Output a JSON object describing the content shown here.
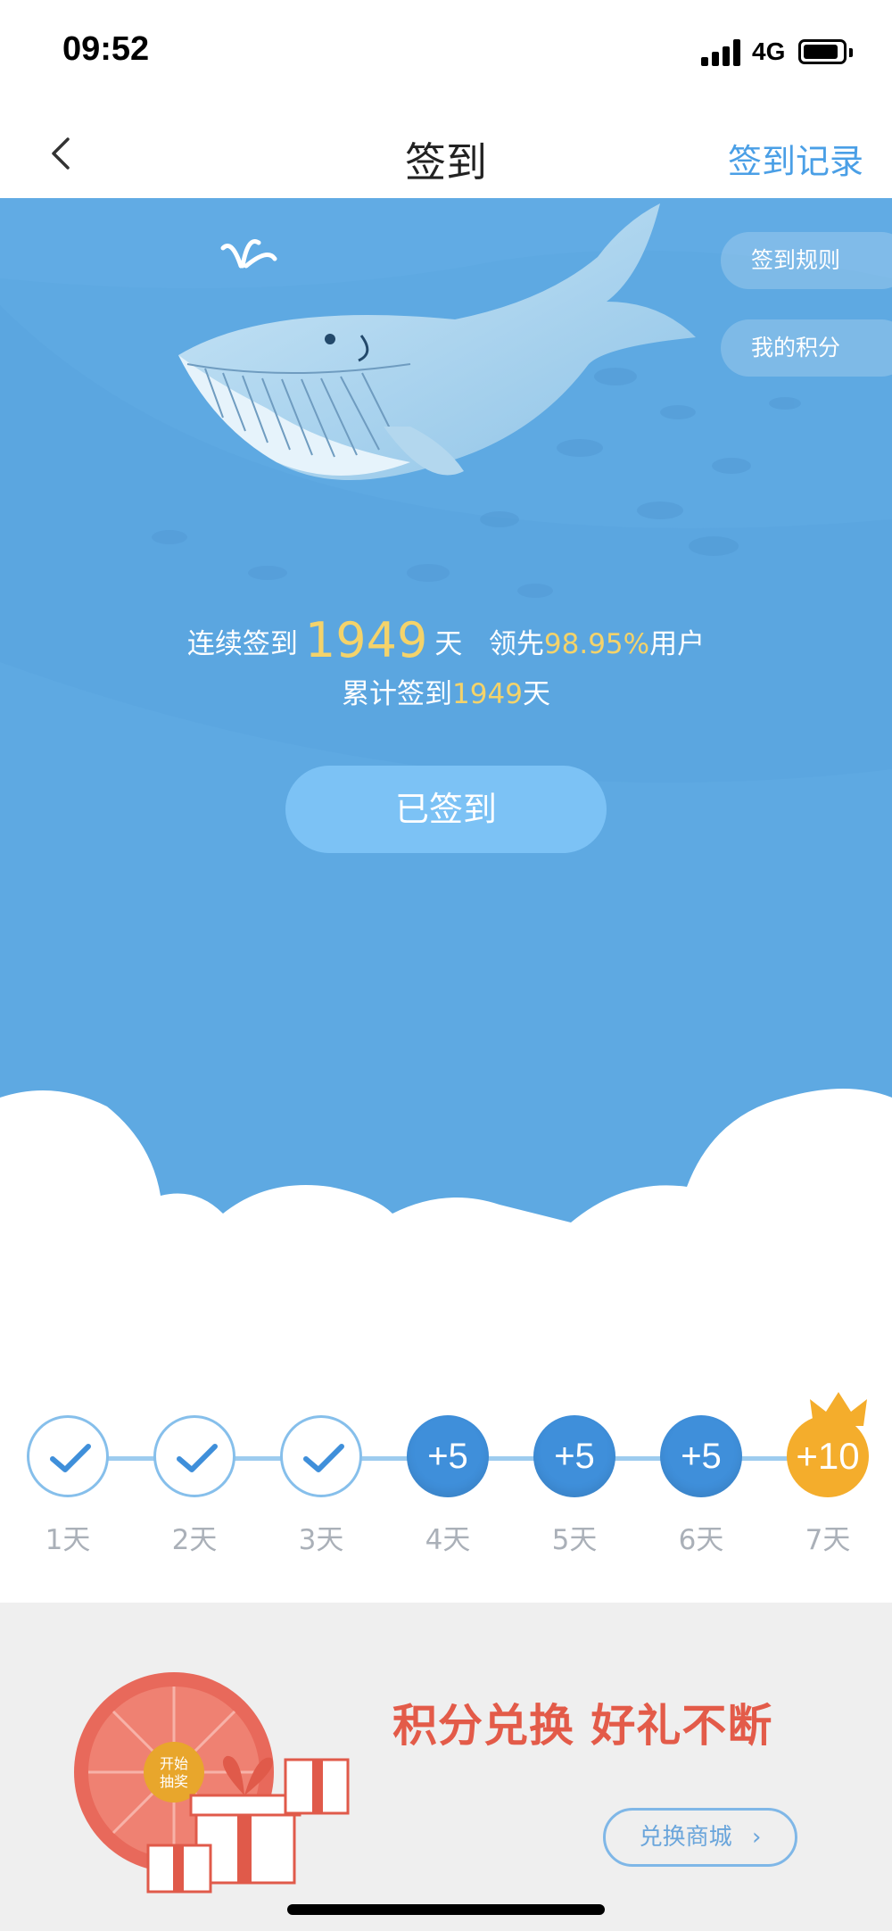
{
  "status_bar": {
    "time": "09:52",
    "network": "4G"
  },
  "nav": {
    "title": "签到",
    "right_link": "签到记录",
    "back_icon": "chevron-left-icon"
  },
  "hero": {
    "side_buttons": [
      "签到规则",
      "我的积分"
    ],
    "stats": {
      "streak_prefix": "连续签到",
      "streak_days": "1949",
      "streak_unit": "天",
      "lead_prefix": "领先",
      "lead_percent": "98.95%",
      "lead_suffix": "用户",
      "total_prefix": "累计签到",
      "total_days": "1949",
      "total_unit": "天"
    },
    "sign_button": "已签到"
  },
  "streak": {
    "days": [
      {
        "label": "1天",
        "state": "done",
        "value": ""
      },
      {
        "label": "2天",
        "state": "done",
        "value": ""
      },
      {
        "label": "3天",
        "state": "done",
        "value": ""
      },
      {
        "label": "4天",
        "state": "todo",
        "value": "+5"
      },
      {
        "label": "5天",
        "state": "todo",
        "value": "+5"
      },
      {
        "label": "6天",
        "state": "todo",
        "value": "+5"
      },
      {
        "label": "7天",
        "state": "gold",
        "value": "+10"
      }
    ]
  },
  "banner": {
    "title": "积分兑换  好礼不断",
    "button": "兑换商城",
    "wheel_center": [
      "开始",
      "抽奖"
    ]
  },
  "colors": {
    "accent": "#4a9fe6",
    "hero_bg": "#5ea9e2",
    "gold": "#f4d36a",
    "banner_red": "#e35b49"
  }
}
